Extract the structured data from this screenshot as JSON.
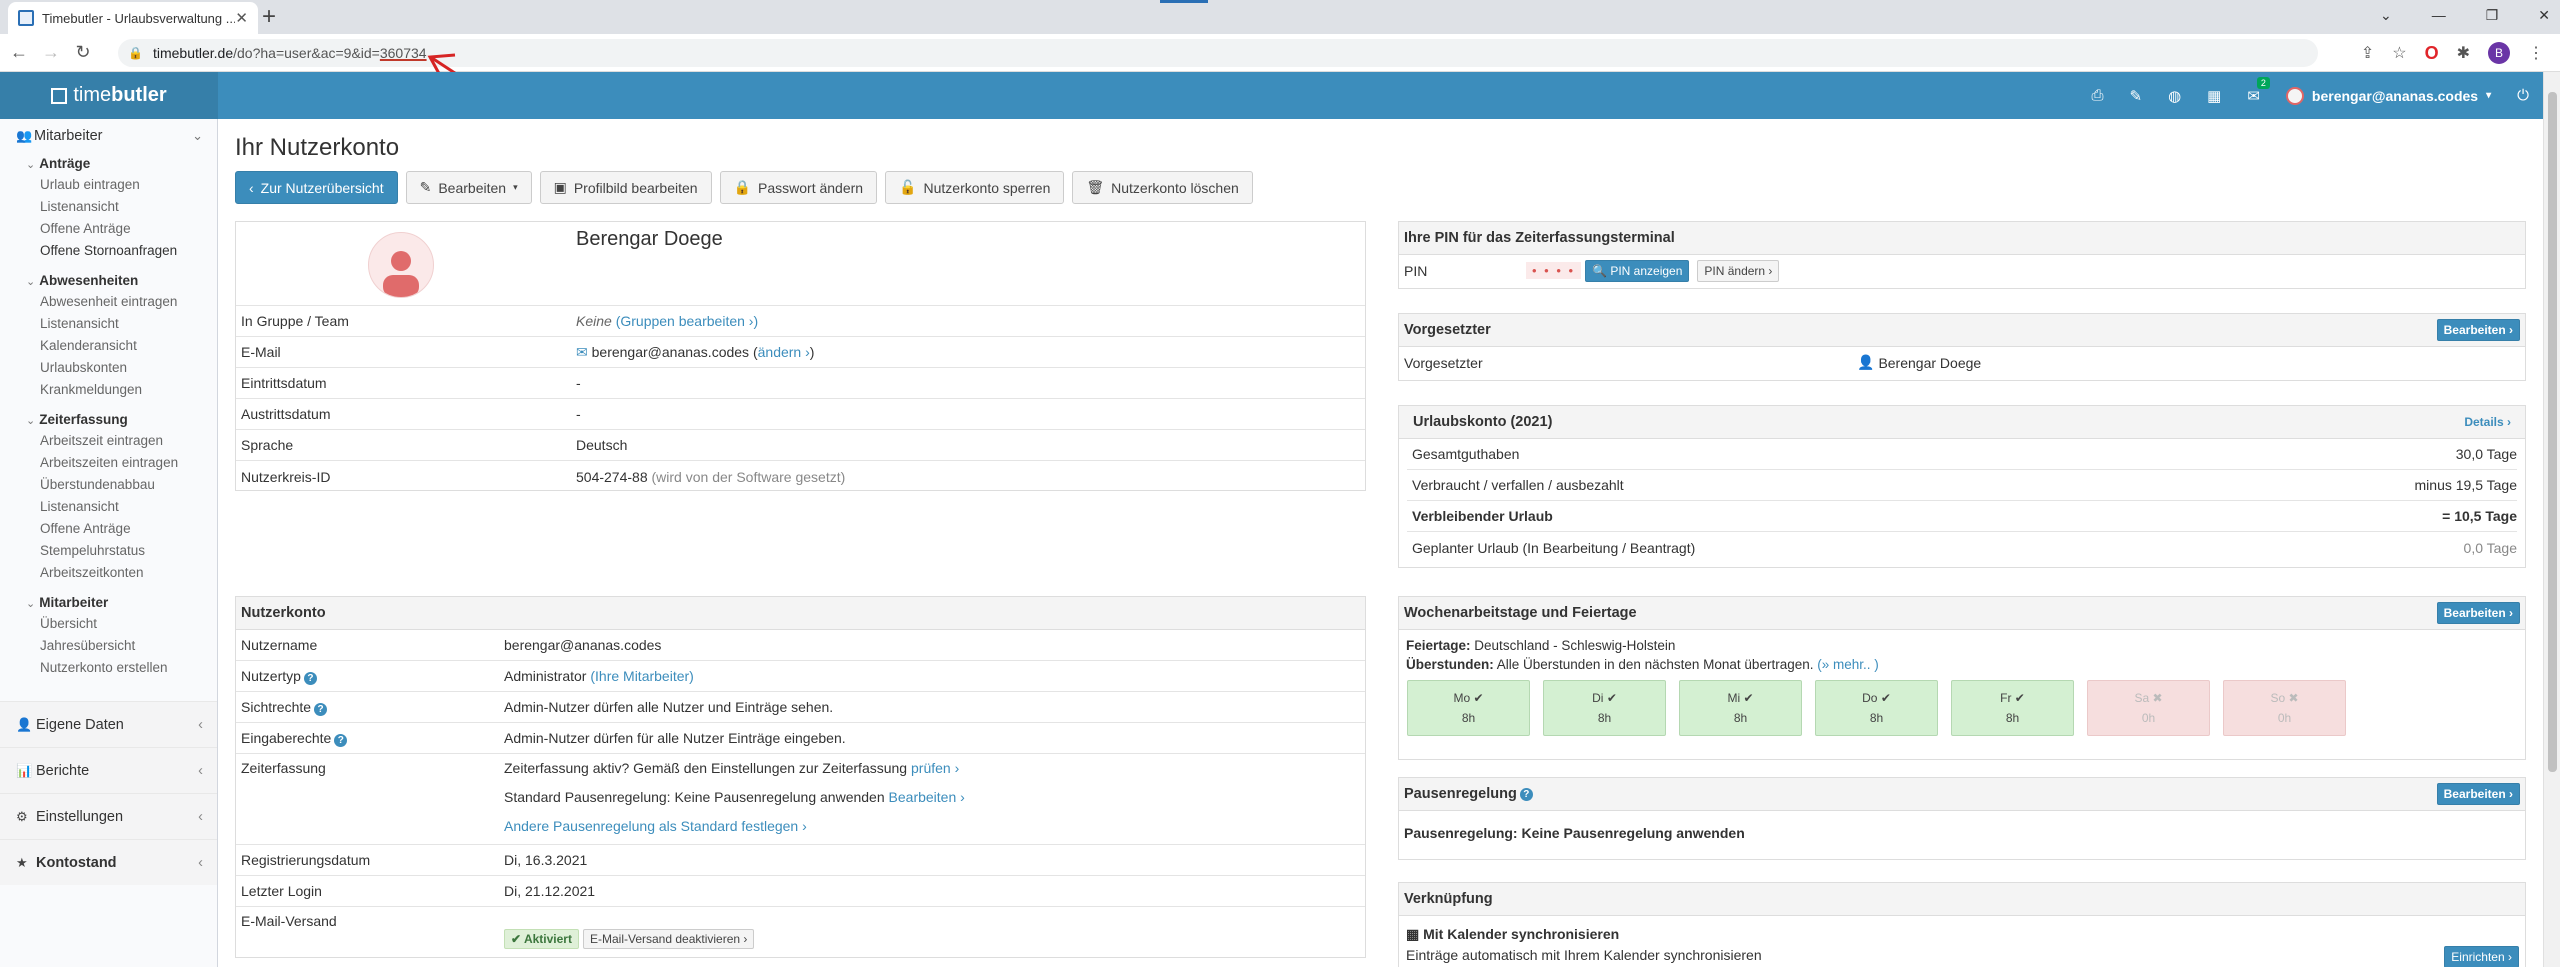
{
  "browser": {
    "tab_title": "Timebutler - Urlaubsverwaltung ...",
    "url_host": "timebutler.de",
    "url_path": "/do?ha=user&ac=9&id=",
    "url_id": "360734"
  },
  "header": {
    "brand_text": "time",
    "brand_bold": "butler",
    "mail_badge": "2",
    "user_email": "berengar@ananas.codes"
  },
  "sidebar": {
    "mitarbeiter_head": "Mitarbeiter",
    "antraege": "Anträge",
    "antraege_items": [
      "Urlaub eintragen",
      "Listenansicht",
      "Offene Anträge",
      "Offene Stornoanfragen"
    ],
    "abwesenheiten": "Abwesenheiten",
    "abwesenheiten_items": [
      "Abwesenheit eintragen",
      "Listenansicht",
      "Kalenderansicht",
      "Urlaubskonten",
      "Krankmeldungen"
    ],
    "zeiterfassung": "Zeiterfassung",
    "zeiterfassung_items": [
      "Arbeitszeit eintragen",
      "Arbeitszeiten eintragen",
      "Überstundenabbau",
      "Listenansicht",
      "Offene Anträge",
      "Stempeluhrstatus",
      "Arbeitszeitkonten"
    ],
    "mitarbeiter_group": "Mitarbeiter",
    "mitarbeiter_items": [
      "Übersicht",
      "Jahresübersicht",
      "Nutzerkonto erstellen"
    ],
    "eigene_daten": "Eigene Daten",
    "berichte": "Berichte",
    "einstellungen": "Einstellungen",
    "kontostand": "Kontostand"
  },
  "page": {
    "title": "Ihr Nutzerkonto",
    "buttons": {
      "back": "Zur Nutzerübersicht",
      "edit": "Bearbeiten",
      "profile_pic": "Profilbild bearbeiten",
      "password": "Passwort ändern",
      "lock": "Nutzerkonto sperren",
      "delete": "Nutzerkonto löschen"
    }
  },
  "profile": {
    "name": "Berengar Doege",
    "rows": [
      {
        "label": "In Gruppe / Team",
        "value": "Keine"
      },
      {
        "label": "E-Mail",
        "value": "berengar@ananas.codes"
      },
      {
        "label": "Eintrittsdatum",
        "value": "-"
      },
      {
        "label": "Austrittsdatum",
        "value": "-"
      },
      {
        "label": "Sprache",
        "value": "Deutsch"
      },
      {
        "label": "Nutzerkreis-ID",
        "value": "504-274-88"
      }
    ],
    "group_link": "(Gruppen bearbeiten ›)",
    "email_link": "ändern ›",
    "kreis_note": "(wird von der Software gesetzt)"
  },
  "account": {
    "title": "Nutzerkonto",
    "username_label": "Nutzername",
    "username": "berengar@ananas.codes",
    "type_label": "Nutzertyp",
    "type_value": "Administrator",
    "type_link": "(Ihre Mitarbeiter)",
    "sicht_label": "Sichtrechte",
    "sicht_value": "Admin-Nutzer dürfen alle Nutzer und Einträge sehen.",
    "eingabe_label": "Eingaberechte",
    "eingabe_value": "Admin-Nutzer dürfen für alle Nutzer Einträge eingeben.",
    "zeit_label": "Zeiterfassung",
    "zeit_line1": "Zeiterfassung aktiv? Gemäß den Einstellungen zur Zeiterfassung",
    "zeit_line1_link": "prüfen ›",
    "zeit_line2": "Standard Pausenregelung: Keine Pausenregelung anwenden",
    "zeit_line2_link": "Bearbeiten ›",
    "zeit_line3_link": "Andere Pausenregelung als Standard festlegen ›",
    "reg_label": "Registrierungsdatum",
    "reg_value": "Di, 16.3.2021",
    "login_label": "Letzter Login",
    "login_value": "Di, 21.12.2021",
    "mail_label": "E-Mail-Versand",
    "mail_active": "Aktiviert",
    "mail_deactivate": "E-Mail-Versand deaktivieren ›"
  },
  "pin": {
    "title": "Ihre PIN für das Zeiterfassungsterminal",
    "label": "PIN",
    "dots": "• • • •",
    "show": "PIN anzeigen",
    "change": "PIN ändern ›"
  },
  "supervisor": {
    "title": "Vorgesetzter",
    "edit": "Bearbeiten ›",
    "label": "Vorgesetzter",
    "name": "Berengar Doege"
  },
  "vacation": {
    "title": "Urlaubskonto (2021)",
    "details": "Details ›",
    "rows": [
      {
        "label": "Gesamtguthaben",
        "value": "30,0 Tage"
      },
      {
        "label": "Verbraucht / verfallen / ausbezahlt",
        "value": "minus 19,5 Tage"
      },
      {
        "label": "Verbleibender Urlaub",
        "value": "= 10,5 Tage"
      },
      {
        "label": "Geplanter Urlaub (In Bearbeitung / Beantragt)",
        "value": "0,0 Tage"
      }
    ]
  },
  "workdays": {
    "title": "Wochenarbeitstage und Feiertage",
    "edit": "Bearbeiten ›",
    "holidays_label": "Feiertage:",
    "holidays_value": "Deutschland - Schleswig-Holstein",
    "overtime_label": "Überstunden:",
    "overtime_value": "Alle Überstunden in den nächsten Monat übertragen.",
    "overtime_link": "(» mehr.. )",
    "days": [
      {
        "name": "Mo",
        "hours": "8h",
        "active": true
      },
      {
        "name": "Di",
        "hours": "8h",
        "active": true
      },
      {
        "name": "Mi",
        "hours": "8h",
        "active": true
      },
      {
        "name": "Do",
        "hours": "8h",
        "active": true
      },
      {
        "name": "Fr",
        "hours": "8h",
        "active": true
      },
      {
        "name": "Sa",
        "hours": "0h",
        "active": false
      },
      {
        "name": "So",
        "hours": "0h",
        "active": false
      }
    ]
  },
  "pause": {
    "title": "Pausenregelung",
    "edit": "Bearbeiten ›",
    "text": "Pausenregelung: Keine Pausenregelung anwenden"
  },
  "link": {
    "title": "Verknüpfung",
    "cal_title": "Mit Kalender synchronisieren",
    "cal_text": "Einträge automatisch mit Ihrem Kalender synchronisieren",
    "setup": "Einrichten ›"
  },
  "colors": {
    "brand": "#3c8dbc",
    "brand_dark": "#367fa9",
    "active_day": "#d4f0d2",
    "off_day": "#f6dede"
  }
}
